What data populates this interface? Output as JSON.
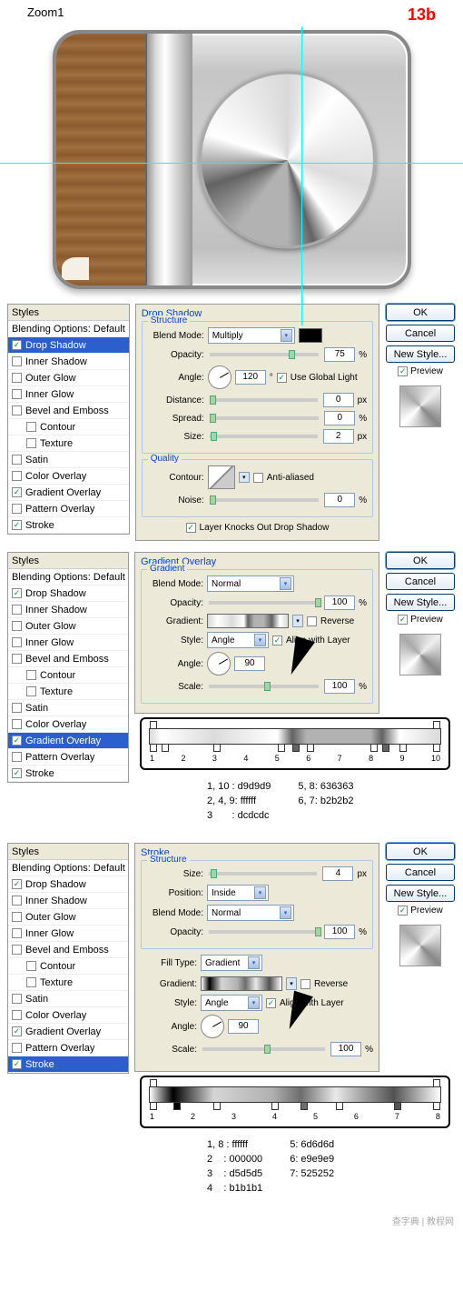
{
  "header": {
    "left": "Zoom1",
    "right": "13b"
  },
  "styles_label": "Styles",
  "blending_label": "Blending Options: Default",
  "effects": {
    "drop_shadow": "Drop Shadow",
    "inner_shadow": "Inner Shadow",
    "outer_glow": "Outer Glow",
    "inner_glow": "Inner Glow",
    "bevel_emboss": "Bevel and Emboss",
    "contour": "Contour",
    "texture": "Texture",
    "satin": "Satin",
    "color_overlay": "Color Overlay",
    "gradient_overlay": "Gradient Overlay",
    "pattern_overlay": "Pattern Overlay",
    "stroke": "Stroke"
  },
  "buttons": {
    "ok": "OK",
    "cancel": "Cancel",
    "new_style": "New Style...",
    "preview": "Preview"
  },
  "panel1": {
    "title": "Drop Shadow",
    "structure": "Structure",
    "blend_mode_l": "Blend Mode:",
    "blend_mode_v": "Multiply",
    "opacity_l": "Opacity:",
    "opacity_v": "75",
    "pct": "%",
    "angle_l": "Angle:",
    "angle_v": "120",
    "deg": "°",
    "ugl": "Use Global Light",
    "distance_l": "Distance:",
    "distance_v": "0",
    "px": "px",
    "spread_l": "Spread:",
    "spread_v": "0",
    "size_l": "Size:",
    "size_v": "2",
    "quality": "Quality",
    "contour_l": "Contour:",
    "aa": "Anti-aliased",
    "noise_l": "Noise:",
    "noise_v": "0",
    "knocks": "Layer Knocks Out Drop Shadow"
  },
  "panel2": {
    "title": "Gradient Overlay",
    "gradient": "Gradient",
    "blend_mode_l": "Blend Mode:",
    "blend_mode_v": "Normal",
    "opacity_l": "Opacity:",
    "opacity_v": "100",
    "pct": "%",
    "gradient_l": "Gradient:",
    "reverse": "Reverse",
    "style_l": "Style:",
    "style_v": "Angle",
    "align": "Align with Layer",
    "angle_l": "Angle:",
    "angle_v": "90",
    "scale_l": "Scale:",
    "scale_v": "100",
    "stops": [
      "1",
      "2",
      "3",
      "4",
      "5",
      "6",
      "7",
      "8",
      "9",
      "10"
    ],
    "legend_col1_l1": "1, 10",
    "legend_col1_v1": ": d9d9d9",
    "legend_col1_l2": "2, 4, 9",
    "legend_col1_v2": ": ffffff",
    "legend_col1_l3": "3",
    "legend_col1_v3": ": dcdcdc",
    "legend_col2_l1": "5, 8",
    "legend_col2_v1": ": 636363",
    "legend_col2_l2": "6, 7",
    "legend_col2_v2": ": b2b2b2"
  },
  "panel3": {
    "title": "Stroke",
    "structure": "Structure",
    "size_l": "Size:",
    "size_v": "4",
    "px": "px",
    "position_l": "Position:",
    "position_v": "Inside",
    "blend_mode_l": "Blend Mode:",
    "blend_mode_v": "Normal",
    "opacity_l": "Opacity:",
    "opacity_v": "100",
    "pct": "%",
    "filltype_l": "Fill Type:",
    "filltype_v": "Gradient",
    "gradient_l": "Gradient:",
    "reverse": "Reverse",
    "style_l": "Style:",
    "style_v": "Angle",
    "align": "Align with Layer",
    "angle_l": "Angle:",
    "angle_v": "90",
    "scale_l": "Scale:",
    "scale_v": "100",
    "stops": [
      "1",
      "2",
      "3",
      "4",
      "5",
      "6",
      "7",
      "8"
    ],
    "legend_col1_l1": "1, 8",
    "legend_col1_v1": ": ffffff",
    "legend_col1_l2": "2",
    "legend_col1_v2": ": 000000",
    "legend_col1_l3": "3",
    "legend_col1_v3": ": d5d5d5",
    "legend_col1_l4": "4",
    "legend_col1_v4": ": b1b1b1",
    "legend_col2_l1": "5",
    "legend_col2_v1": ": 6d6d6d",
    "legend_col2_l2": "6",
    "legend_col2_v2": ": e9e9e9",
    "legend_col2_l3": "7",
    "legend_col2_v3": ": 525252"
  },
  "watermark": "查字典 | 教程网"
}
